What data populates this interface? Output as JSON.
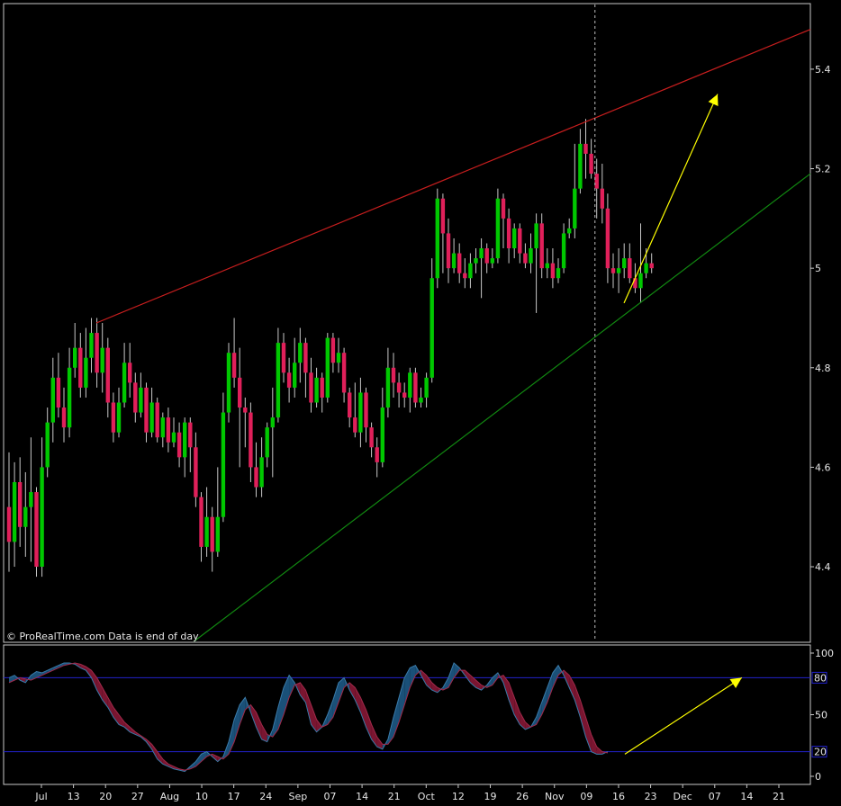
{
  "watermark": "© ProRealTime.com  Data is end of day",
  "colors": {
    "background": "#000000",
    "frame": "#c8c8c8",
    "up_candle": "#00c800",
    "down_candle": "#e0205a",
    "resistance_line": "#c81e1e",
    "support_line": "#118811",
    "projection_arrow": "#ffff00",
    "stoch_levels": "#2222cc",
    "stoch_up_fill": "#1a5078",
    "stoch_down_fill": "#7a1530"
  },
  "chart_data": [
    {
      "type": "candlestick",
      "x_tick_labels": [
        "Jul",
        "13",
        "20",
        "27",
        "Aug",
        "10",
        "17",
        "24",
        "Sep",
        "07",
        "14",
        "21",
        "Oct",
        "12",
        "19",
        "26",
        "Nov",
        "09",
        "16",
        "23",
        "Dec",
        "07",
        "14",
        "21"
      ],
      "y_ticks": [
        "4.4",
        "4.6",
        "4.8",
        "5",
        "5.2",
        "5.4"
      ],
      "ylim": [
        4.25,
        5.53
      ],
      "candles": [
        [
          4.52,
          4.45,
          4.63,
          4.39
        ],
        [
          4.45,
          4.57,
          4.61,
          4.4
        ],
        [
          4.57,
          4.48,
          4.62,
          4.44
        ],
        [
          4.48,
          4.52,
          4.59,
          4.42
        ],
        [
          4.52,
          4.55,
          4.66,
          4.41
        ],
        [
          4.55,
          4.4,
          4.56,
          4.38
        ],
        [
          4.4,
          4.6,
          4.66,
          4.38
        ],
        [
          4.6,
          4.69,
          4.72,
          4.58
        ],
        [
          4.69,
          4.78,
          4.82,
          4.65
        ],
        [
          4.78,
          4.72,
          4.83,
          4.7
        ],
        [
          4.72,
          4.68,
          4.76,
          4.65
        ],
        [
          4.68,
          4.8,
          4.84,
          4.66
        ],
        [
          4.8,
          4.84,
          4.89,
          4.78
        ],
        [
          4.84,
          4.76,
          4.87,
          4.74
        ],
        [
          4.76,
          4.82,
          4.88,
          4.74
        ],
        [
          4.82,
          4.87,
          4.9,
          4.79
        ],
        [
          4.87,
          4.79,
          4.9,
          4.76
        ],
        [
          4.79,
          4.84,
          4.89,
          4.75
        ],
        [
          4.84,
          4.73,
          4.86,
          4.7
        ],
        [
          4.73,
          4.67,
          4.75,
          4.65
        ],
        [
          4.67,
          4.73,
          4.76,
          4.66
        ],
        [
          4.73,
          4.81,
          4.85,
          4.72
        ],
        [
          4.81,
          4.77,
          4.85,
          4.74
        ],
        [
          4.77,
          4.71,
          4.79,
          4.69
        ],
        [
          4.71,
          4.76,
          4.79,
          4.7
        ],
        [
          4.76,
          4.67,
          4.77,
          4.65
        ],
        [
          4.67,
          4.73,
          4.76,
          4.66
        ],
        [
          4.73,
          4.66,
          4.74,
          4.65
        ],
        [
          4.66,
          4.7,
          4.71,
          4.64
        ],
        [
          4.7,
          4.65,
          4.72,
          4.63
        ],
        [
          4.65,
          4.67,
          4.7,
          4.64
        ],
        [
          4.67,
          4.62,
          4.69,
          4.6
        ],
        [
          4.62,
          4.69,
          4.7,
          4.58
        ],
        [
          4.69,
          4.64,
          4.7,
          4.59
        ],
        [
          4.64,
          4.54,
          4.67,
          4.52
        ],
        [
          4.54,
          4.44,
          4.55,
          4.41
        ],
        [
          4.44,
          4.5,
          4.56,
          4.42
        ],
        [
          4.5,
          4.43,
          4.52,
          4.39
        ],
        [
          4.43,
          4.5,
          4.6,
          4.42
        ],
        [
          4.5,
          4.71,
          4.75,
          4.49
        ],
        [
          4.71,
          4.83,
          4.85,
          4.69
        ],
        [
          4.83,
          4.78,
          4.9,
          4.76
        ],
        [
          4.78,
          4.72,
          4.84,
          4.6
        ],
        [
          4.72,
          4.71,
          4.74,
          4.64
        ],
        [
          4.71,
          4.6,
          4.73,
          4.57
        ],
        [
          4.6,
          4.56,
          4.65,
          4.54
        ],
        [
          4.56,
          4.62,
          4.66,
          4.54
        ],
        [
          4.62,
          4.68,
          4.69,
          4.6
        ],
        [
          4.68,
          4.7,
          4.76,
          4.58
        ],
        [
          4.7,
          4.85,
          4.88,
          4.69
        ],
        [
          4.85,
          4.79,
          4.87,
          4.77
        ],
        [
          4.79,
          4.76,
          4.82,
          4.73
        ],
        [
          4.76,
          4.81,
          4.86,
          4.74
        ],
        [
          4.81,
          4.85,
          4.88,
          4.77
        ],
        [
          4.85,
          4.79,
          4.86,
          4.74
        ],
        [
          4.79,
          4.73,
          4.82,
          4.71
        ],
        [
          4.73,
          4.78,
          4.8,
          4.72
        ],
        [
          4.78,
          4.74,
          4.79,
          4.71
        ],
        [
          4.74,
          4.86,
          4.87,
          4.73
        ],
        [
          4.86,
          4.81,
          4.87,
          4.79
        ],
        [
          4.81,
          4.83,
          4.86,
          4.79
        ],
        [
          4.83,
          4.75,
          4.84,
          4.73
        ],
        [
          4.75,
          4.7,
          4.76,
          4.68
        ],
        [
          4.7,
          4.67,
          4.77,
          4.66
        ],
        [
          4.67,
          4.75,
          4.78,
          4.64
        ],
        [
          4.75,
          4.68,
          4.76,
          4.65
        ],
        [
          4.68,
          4.64,
          4.69,
          4.62
        ],
        [
          4.64,
          4.61,
          4.66,
          4.58
        ],
        [
          4.61,
          4.72,
          4.76,
          4.6
        ],
        [
          4.72,
          4.8,
          4.84,
          4.7
        ],
        [
          4.8,
          4.77,
          4.83,
          4.74
        ],
        [
          4.77,
          4.75,
          4.79,
          4.72
        ],
        [
          4.75,
          4.74,
          4.77,
          4.72
        ],
        [
          4.74,
          4.79,
          4.8,
          4.71
        ],
        [
          4.79,
          4.73,
          4.8,
          4.72
        ],
        [
          4.73,
          4.74,
          4.76,
          4.72
        ],
        [
          4.74,
          4.78,
          4.79,
          4.72
        ],
        [
          4.78,
          4.98,
          5.02,
          4.77
        ],
        [
          4.98,
          5.14,
          5.16,
          4.96
        ],
        [
          5.14,
          5.07,
          5.15,
          4.99
        ],
        [
          5.07,
          5.0,
          5.1,
          4.97
        ],
        [
          5.0,
          5.03,
          5.06,
          4.99
        ],
        [
          5.03,
          4.99,
          5.05,
          4.97
        ],
        [
          4.99,
          4.98,
          5.02,
          4.96
        ],
        [
          4.98,
          5.01,
          5.03,
          4.96
        ],
        [
          5.01,
          5.02,
          5.04,
          4.99
        ],
        [
          5.02,
          5.04,
          5.06,
          4.94
        ],
        [
          5.04,
          5.01,
          5.05,
          4.99
        ],
        [
          5.01,
          5.02,
          5.04,
          5.0
        ],
        [
          5.02,
          5.14,
          5.16,
          5.01
        ],
        [
          5.14,
          5.1,
          5.15,
          5.04
        ],
        [
          5.1,
          5.04,
          5.12,
          5.01
        ],
        [
          5.04,
          5.08,
          5.09,
          5.02
        ],
        [
          5.08,
          5.03,
          5.09,
          5.01
        ],
        [
          5.03,
          5.01,
          5.05,
          5.0
        ],
        [
          5.01,
          5.04,
          5.07,
          4.99
        ],
        [
          5.04,
          5.09,
          5.11,
          4.91
        ],
        [
          5.09,
          5.0,
          5.11,
          4.98
        ],
        [
          5.0,
          5.01,
          5.04,
          4.98
        ],
        [
          5.01,
          4.98,
          5.04,
          4.96
        ],
        [
          4.98,
          5.0,
          5.02,
          4.97
        ],
        [
          5.0,
          5.07,
          5.09,
          4.99
        ],
        [
          5.07,
          5.08,
          5.1,
          5.06
        ],
        [
          5.08,
          5.16,
          5.25,
          5.06
        ],
        [
          5.16,
          5.25,
          5.28,
          5.15
        ],
        [
          5.25,
          5.23,
          5.3,
          5.18
        ],
        [
          5.23,
          5.19,
          5.26,
          5.18
        ],
        [
          5.19,
          5.16,
          5.22,
          5.1
        ],
        [
          5.16,
          5.12,
          5.21,
          5.09
        ],
        [
          5.12,
          5.0,
          5.15,
          4.97
        ],
        [
          5.0,
          4.99,
          5.03,
          4.96
        ],
        [
          4.99,
          5.0,
          5.04,
          4.95
        ],
        [
          5.0,
          5.02,
          5.05,
          4.98
        ],
        [
          5.02,
          4.98,
          5.05,
          4.97
        ],
        [
          4.98,
          4.96,
          5.01,
          4.95
        ],
        [
          4.96,
          4.99,
          5.09,
          4.93
        ],
        [
          4.99,
          5.01,
          5.04,
          4.98
        ],
        [
          5.01,
          5.0,
          5.03,
          4.99
        ]
      ],
      "resistance_line": {
        "from": [
          0.115,
          4.89
        ],
        "to": [
          1.0,
          5.48
        ]
      },
      "support_line": {
        "from": [
          0.236,
          4.25
        ],
        "to": [
          1.0,
          5.19
        ]
      },
      "projection_arrow": {
        "from": [
          0.769,
          4.93
        ],
        "to": [
          0.885,
          5.35
        ]
      },
      "current_bar_marker": 0.733
    },
    {
      "type": "line",
      "y_ticks": [
        "0",
        "50",
        "100"
      ],
      "ylim": [
        0,
        100
      ],
      "levels": [
        {
          "value": 80,
          "label": "80"
        },
        {
          "value": 20,
          "label": "20"
        }
      ],
      "k": [
        80,
        82,
        78,
        76,
        82,
        85,
        84,
        86,
        88,
        90,
        92,
        92,
        91,
        88,
        86,
        80,
        70,
        62,
        56,
        48,
        42,
        40,
        36,
        34,
        32,
        28,
        22,
        14,
        10,
        8,
        6,
        5,
        4,
        8,
        12,
        18,
        20,
        16,
        12,
        16,
        28,
        46,
        58,
        64,
        52,
        40,
        30,
        28,
        38,
        56,
        72,
        82,
        76,
        66,
        60,
        42,
        36,
        40,
        50,
        62,
        76,
        80,
        70,
        62,
        52,
        40,
        30,
        24,
        22,
        30,
        48,
        64,
        80,
        88,
        90,
        82,
        74,
        70,
        68,
        72,
        80,
        92,
        88,
        82,
        76,
        72,
        70,
        74,
        80,
        84,
        76,
        62,
        50,
        42,
        38,
        40,
        48,
        60,
        72,
        84,
        90,
        82,
        72,
        62,
        48,
        32,
        20,
        18,
        18,
        20
      ],
      "d": [
        76,
        78,
        80,
        79,
        78,
        80,
        82,
        84,
        86,
        88,
        90,
        91,
        92,
        91,
        89,
        86,
        80,
        72,
        64,
        56,
        50,
        44,
        40,
        36,
        33,
        30,
        26,
        20,
        14,
        10,
        8,
        6,
        5,
        6,
        8,
        12,
        16,
        18,
        16,
        14,
        18,
        28,
        42,
        54,
        58,
        52,
        42,
        34,
        32,
        38,
        50,
        64,
        74,
        76,
        70,
        58,
        46,
        40,
        42,
        48,
        60,
        72,
        76,
        72,
        64,
        54,
        42,
        32,
        26,
        26,
        32,
        44,
        58,
        72,
        82,
        86,
        82,
        76,
        72,
        70,
        72,
        80,
        86,
        86,
        82,
        78,
        74,
        72,
        74,
        80,
        82,
        76,
        64,
        52,
        44,
        40,
        42,
        50,
        60,
        72,
        82,
        86,
        82,
        74,
        62,
        48,
        34,
        24,
        20,
        19
      ]
    }
  ]
}
